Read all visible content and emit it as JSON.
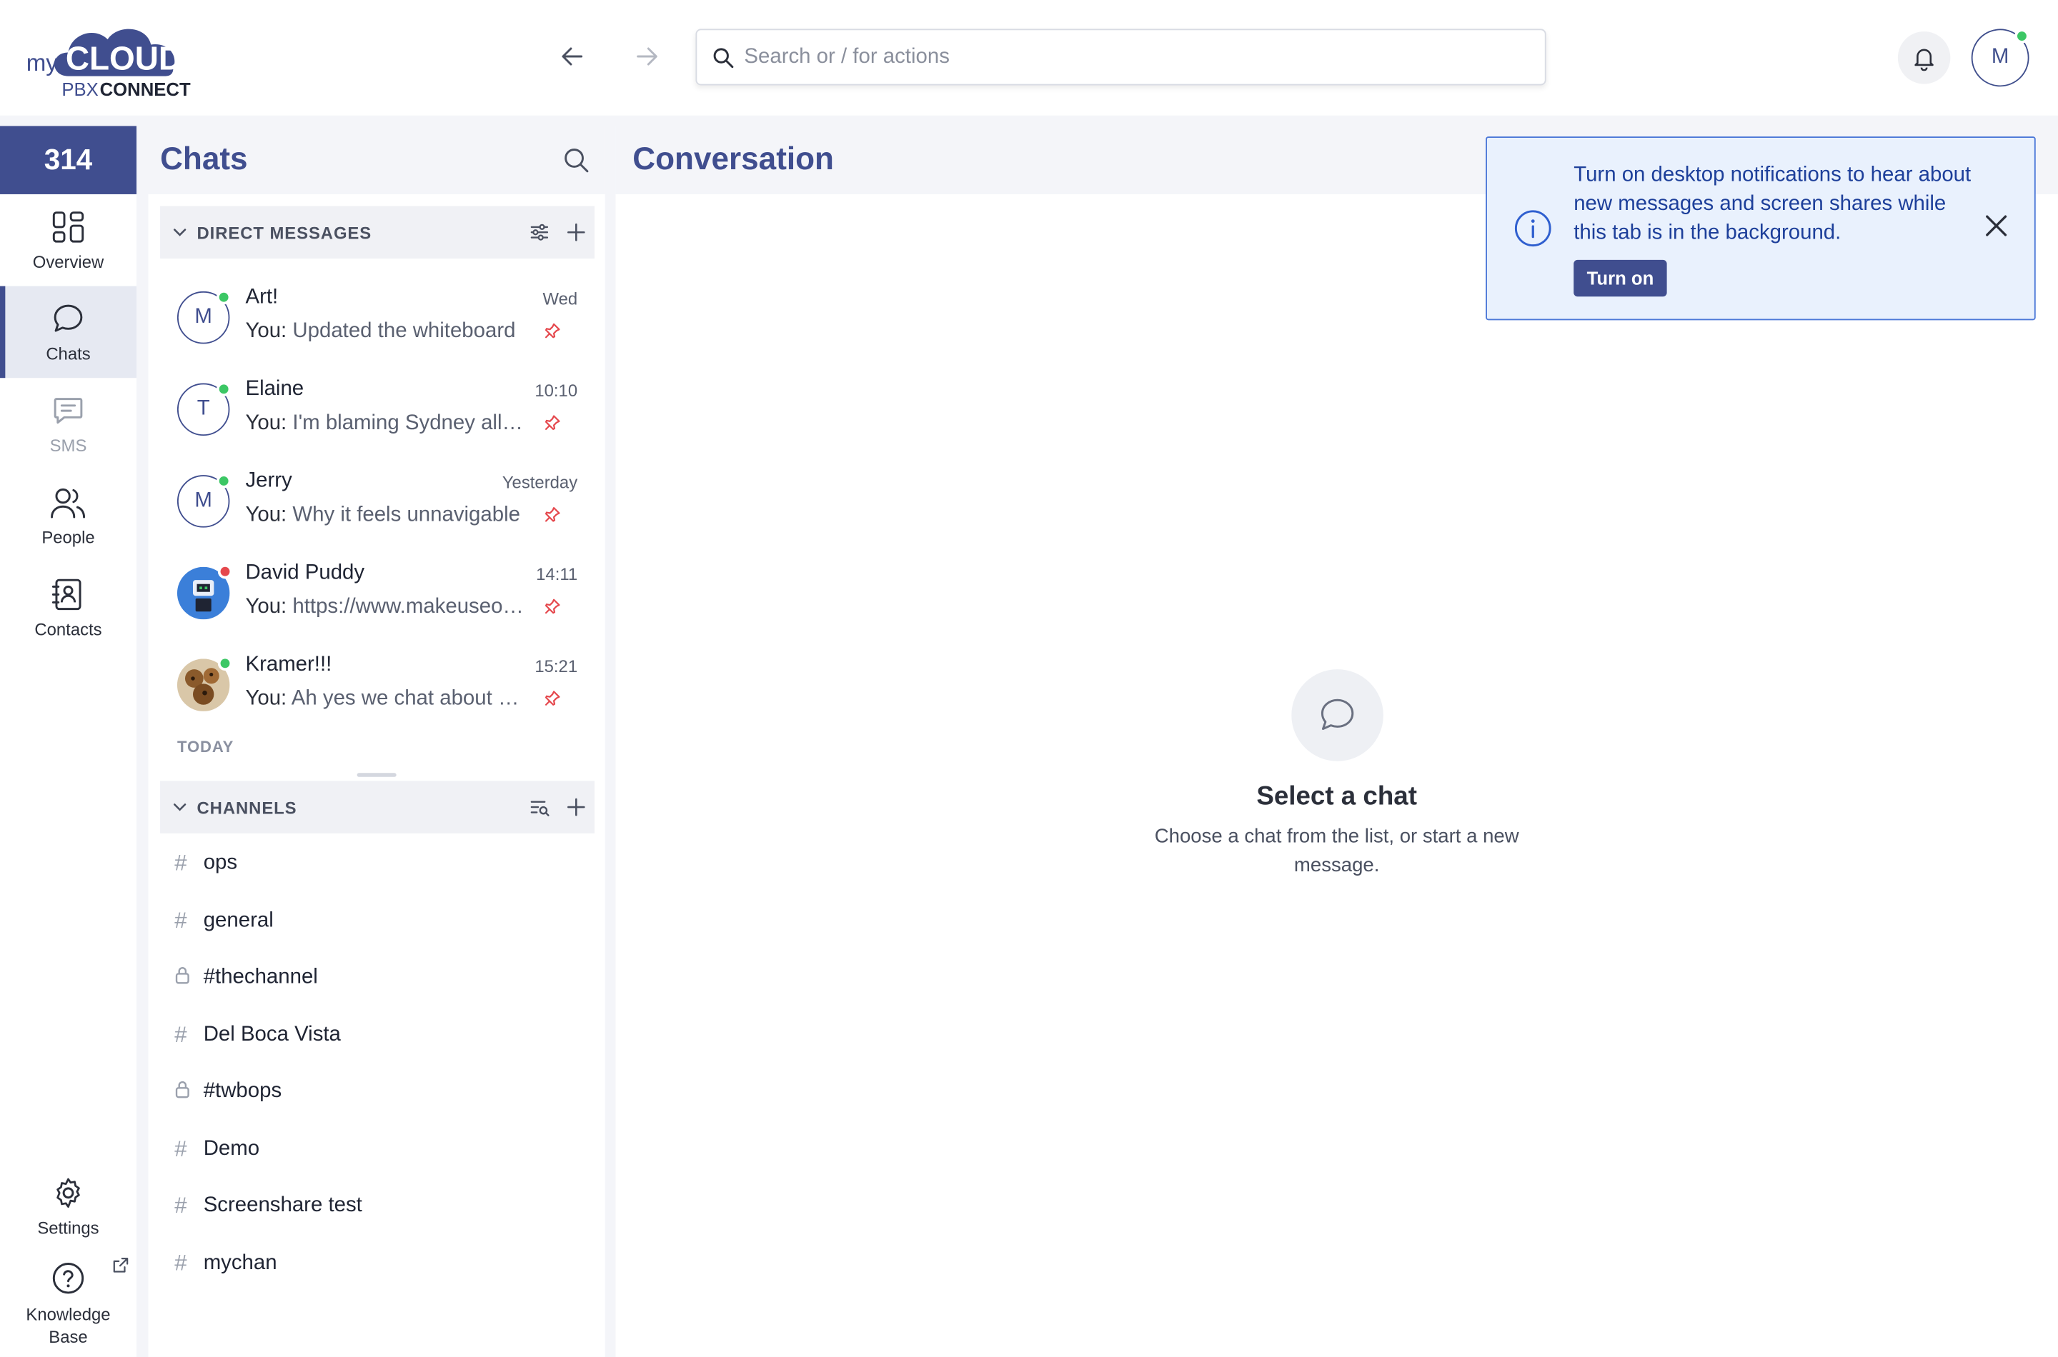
{
  "brand": {
    "my": "my",
    "cloud": "CLOUD",
    "pbx": "PBX",
    "connect": "CONNECT"
  },
  "header": {
    "search_placeholder": "Search or / for actions",
    "user_initial": "M"
  },
  "rail": {
    "extension": "314",
    "items": [
      {
        "label": "Overview",
        "icon": "grid-icon"
      },
      {
        "label": "Chats",
        "icon": "chat-bubble-icon"
      },
      {
        "label": "SMS",
        "icon": "sms-icon"
      },
      {
        "label": "People",
        "icon": "people-icon"
      },
      {
        "label": "Contacts",
        "icon": "contact-book-icon"
      }
    ],
    "settings_label": "Settings",
    "kb_label": "Knowledge Base"
  },
  "chats": {
    "title": "Chats",
    "direct_messages_label": "DIRECT MESSAGES",
    "today_label": "TODAY",
    "channels_label": "CHANNELS",
    "dms": [
      {
        "initial": "M",
        "name": "Art!",
        "time": "Wed",
        "you": "You:",
        "message": "Updated the whiteboard",
        "status": "#3cc765"
      },
      {
        "initial": "T",
        "name": "Elaine",
        "time": "10:10",
        "you": "You:",
        "message": "I'm blaming Sydney all day",
        "status": "#3cc765"
      },
      {
        "initial": "M",
        "name": "Jerry",
        "time": "Yesterday",
        "you": "You:",
        "message": "Why it feels unnavigable",
        "status": "#3cc765"
      },
      {
        "initial": "",
        "name": "David Puddy",
        "time": "14:11",
        "you": "You:",
        "message": "https://www.makeuseof.com",
        "status": "#e5484d"
      },
      {
        "initial": "",
        "name": "Kramer!!!",
        "time": "15:21",
        "you": "You:",
        "message": "Ah yes we chat about the",
        "status": "#3cc765"
      }
    ],
    "channels": [
      {
        "name": "ops",
        "glyph": "hash-icon"
      },
      {
        "name": "general",
        "glyph": "hash-icon"
      },
      {
        "name": "#thechannel",
        "glyph": "lock-icon"
      },
      {
        "name": "Del Boca Vista",
        "glyph": "hash-icon"
      },
      {
        "name": "#twbops",
        "glyph": "lock-icon"
      },
      {
        "name": "Demo",
        "glyph": "hash-icon"
      },
      {
        "name": "Screenshare test",
        "glyph": "hash-icon"
      },
      {
        "name": "mychan",
        "glyph": "hash-icon"
      }
    ]
  },
  "conversation": {
    "title": "Conversation",
    "empty_title": "Select a chat",
    "empty_subtitle": "Choose a chat from the list, or start a new message."
  },
  "toast": {
    "text": "Turn on desktop notifications to hear about new messages and screen shares while this tab is in the background.",
    "button": "Turn on"
  },
  "colors": {
    "brand": "#404e8f",
    "online": "#3cc765",
    "busy": "#e5484d",
    "toast_bg": "#e9f1fd"
  }
}
